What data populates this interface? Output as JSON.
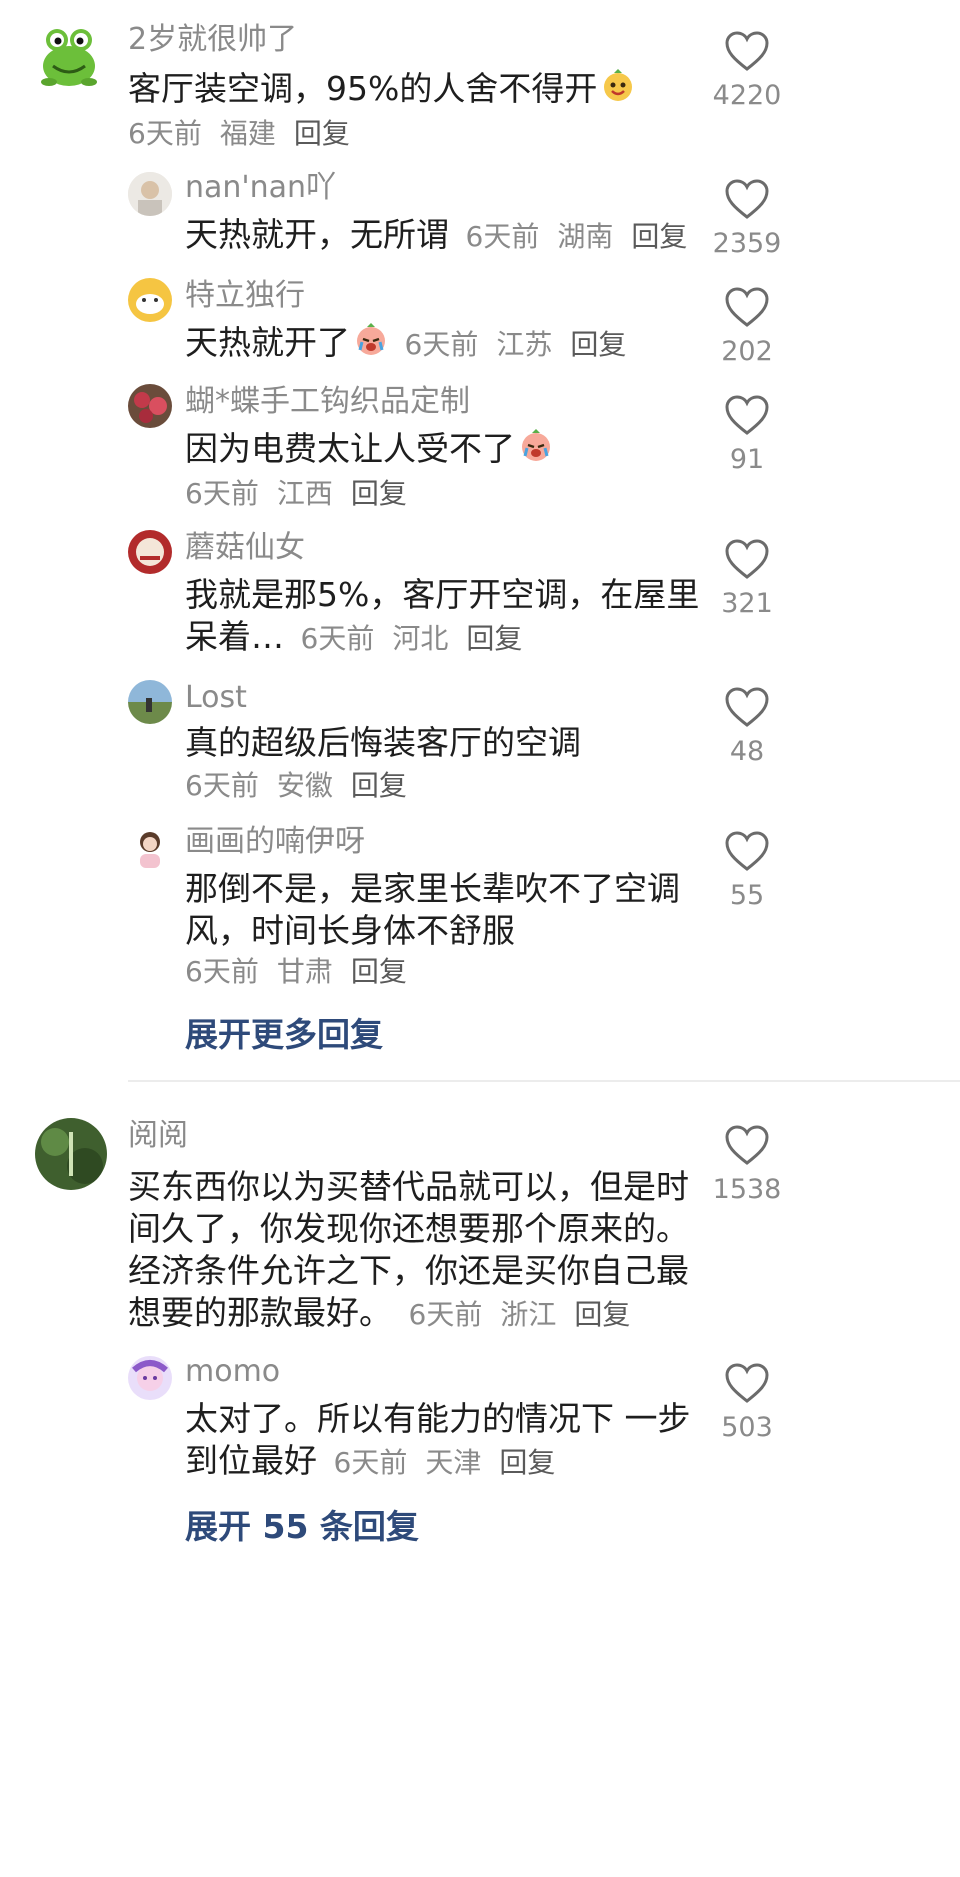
{
  "comments": [
    {
      "username": "2岁就很帅了",
      "text": "客厅装空调，95%的人舍不得开",
      "time": "6天前",
      "location": "福建",
      "reply": "回复",
      "likes": "4220",
      "avatar_icon": "frog-avatar",
      "replies": [
        {
          "username": "nan'nan吖",
          "text": "天热就开，无所谓",
          "time": "6天前",
          "location": "湖南",
          "reply": "回复",
          "likes": "2359",
          "avatar_icon": "photo-avatar"
        },
        {
          "username": "特立独行",
          "text": "天热就开了",
          "time": "6天前",
          "location": "江苏",
          "reply": "回复",
          "likes": "202",
          "avatar_icon": "cartoon-avatar",
          "emoji_icon": "crying-emoji-icon"
        },
        {
          "username": "蝴*蝶手工钩织品定制",
          "text": "因为电费太让人受不了",
          "time": "6天前",
          "location": "江西",
          "reply": "回复",
          "likes": "91",
          "avatar_icon": "flower-avatar",
          "emoji_icon": "crying-emoji-icon"
        },
        {
          "username": "蘑菇仙女",
          "text1": "我就是那5%，客厅开空调，在屋里",
          "text2": "呆着…",
          "time": "6天前",
          "location": "河北",
          "reply": "回复",
          "likes": "321",
          "avatar_icon": "badge-avatar"
        },
        {
          "username": "Lost",
          "text": "真的超级后悔装客厅的空调",
          "time": "6天前",
          "location": "安徽",
          "reply": "回复",
          "likes": "48",
          "avatar_icon": "landscape-avatar"
        },
        {
          "username": "画画的喃伊呀",
          "text1": "那倒不是，是家里长辈吹不了空调",
          "text2": "风，时间长身体不舒服",
          "time": "6天前",
          "location": "甘肃",
          "reply": "回复",
          "likes": "55",
          "avatar_icon": "girl-avatar"
        }
      ],
      "expand_label": "展开更多回复"
    },
    {
      "username": "阅阅",
      "text_lines": [
        "买东西你以为买替代品就可以，但是时",
        "间久了，你发现你还想要那个原来的。",
        "经济条件允许之下，你还是买你自己最",
        "想要的那款最好。"
      ],
      "time": "6天前",
      "location": "浙江",
      "reply": "回复",
      "likes": "1538",
      "avatar_icon": "green-avatar",
      "replies": [
        {
          "username": "momo",
          "text1": "太对了。所以有能力的情况下 一步",
          "text2": "到位最好",
          "time": "6天前",
          "location": "天津",
          "reply": "回复",
          "likes": "503",
          "avatar_icon": "anime-avatar"
        }
      ],
      "expand_label": "展开 55 条回复"
    }
  ]
}
